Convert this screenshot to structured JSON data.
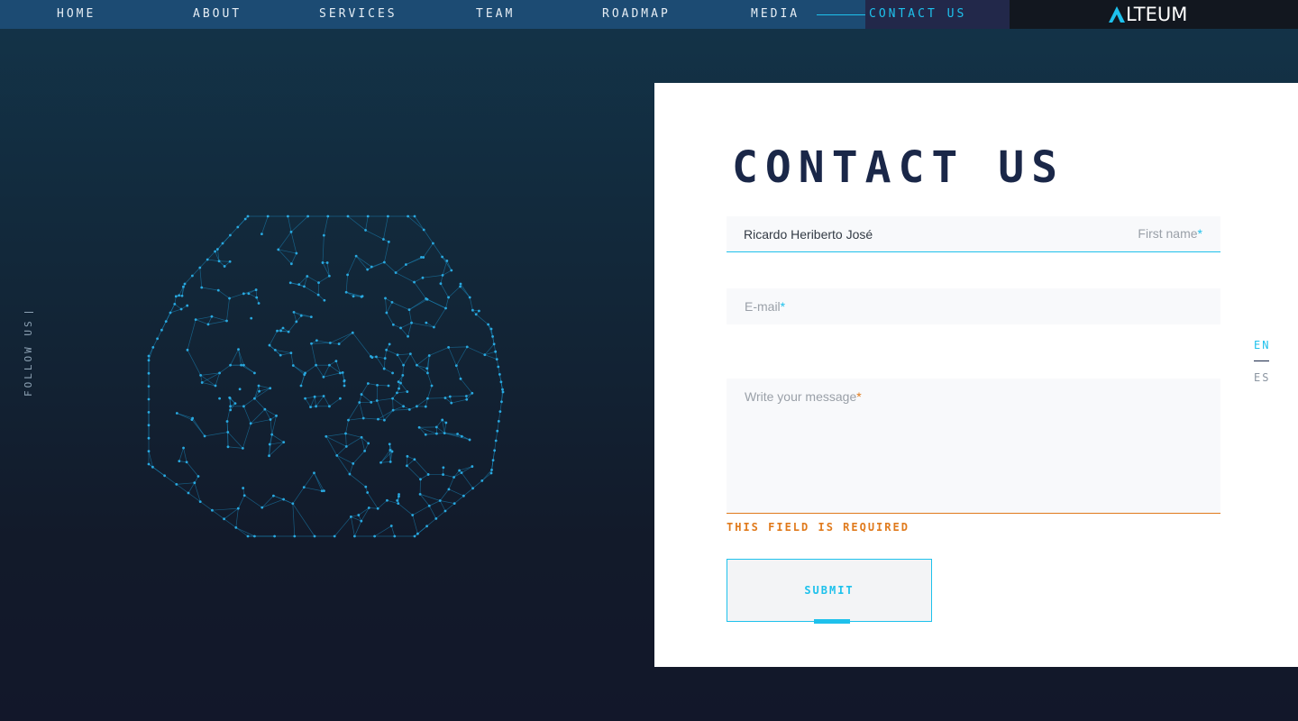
{
  "nav": {
    "items": [
      {
        "label": "HOME"
      },
      {
        "label": "ABOUT"
      },
      {
        "label": "SERVICES"
      },
      {
        "label": "TEAM"
      },
      {
        "label": "ROADMAP"
      },
      {
        "label": "MEDIA"
      }
    ],
    "active_label": "CONTACT US",
    "brand": "LTEUM",
    "logo_icon": "alteum-a-logo-icon"
  },
  "sidebar": {
    "follow_label": "FOLLOW US"
  },
  "form": {
    "title": "CONTACT US",
    "first_name": {
      "value": "Ricardo Heriberto José",
      "label": "First name",
      "required_mark": "*"
    },
    "email": {
      "placeholder": "E-mail",
      "required_mark": "*"
    },
    "message": {
      "placeholder": "Write your message",
      "required_mark": "*"
    },
    "error": "THIS FIELD IS REQUIRED",
    "submit_label": "SUBMIT"
  },
  "language": {
    "options": [
      "EN",
      "ES"
    ],
    "selected": "EN"
  },
  "colors": {
    "accent": "#1ec1ec",
    "error": "#e07a1c",
    "heading": "#1a2748",
    "nav_bg": "#1c4b73"
  }
}
